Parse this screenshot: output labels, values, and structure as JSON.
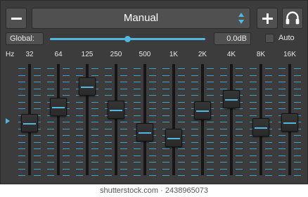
{
  "toolbar": {
    "remove_preset_icon": "minus-icon",
    "preset_value": "Manual",
    "preset_arrows_icon": "up-down-arrows-icon",
    "add_preset_icon": "plus-icon",
    "headphones_icon": "headphones-icon"
  },
  "global": {
    "label": "Global:",
    "value": "0.0dB",
    "slider_level": 0.5,
    "auto_label": "Auto",
    "auto_checked": false
  },
  "bands": {
    "unit_label": "Hz",
    "zero_marker_icon": "triangle-right-icon",
    "items": [
      {
        "label": "32",
        "level": 0.45
      },
      {
        "label": "64",
        "level": 0.63
      },
      {
        "label": "125",
        "level": 0.86
      },
      {
        "label": "250",
        "level": 0.6
      },
      {
        "label": "500",
        "level": 0.35
      },
      {
        "label": "1K",
        "level": 0.29
      },
      {
        "label": "2K",
        "level": 0.59
      },
      {
        "label": "4K",
        "level": 0.72
      },
      {
        "label": "8K",
        "level": 0.41
      },
      {
        "label": "16K",
        "level": 0.46
      }
    ]
  },
  "colors": {
    "accent": "#4fb7e0",
    "background": "#3c3c3c",
    "control": "#505050"
  },
  "watermark": "shutterstock.com · 2438965073"
}
